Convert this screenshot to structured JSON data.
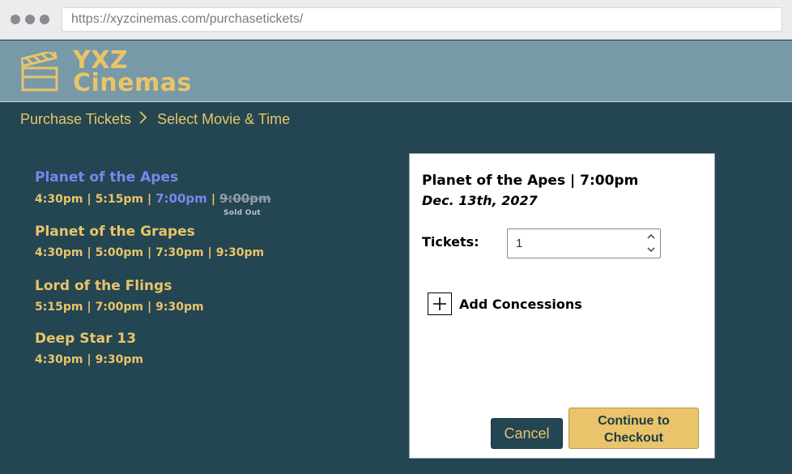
{
  "browser": {
    "url": "https://xyzcinemas.com/purchasetickets/"
  },
  "header": {
    "logo_line1": "YXZ",
    "logo_line2": "Cinemas"
  },
  "breadcrumb": {
    "items": [
      "Purchase Tickets",
      "Select Movie & Time"
    ],
    "separator": ">"
  },
  "movies": [
    {
      "title": "Planet of the Apes",
      "selected": true,
      "times": [
        "4:30pm",
        "5:15pm",
        "7:00pm",
        "9:00pm"
      ],
      "selected_time": "7:00pm",
      "sold_out_time": "9:00pm",
      "sold_out_label": "Sold Out"
    },
    {
      "title": "Planet of the Grapes",
      "times": [
        "4:30pm",
        "5:00pm",
        "7:30pm",
        "9:30pm"
      ]
    },
    {
      "title": "Lord of the Flings",
      "times": [
        "5:15pm",
        "7:00pm",
        "9:30pm"
      ]
    },
    {
      "title": "Deep Star 13",
      "times": [
        "4:30pm",
        "9:30pm"
      ]
    }
  ],
  "panel": {
    "title": "Planet of the Apes | 7:00pm",
    "date": "Dec. 13th, 2027",
    "tickets_label": "Tickets:",
    "tickets_value": "1",
    "add_concessions_label": "Add Concessions",
    "cancel_label": "Cancel",
    "checkout_label": "Continue to\nCheckout"
  },
  "colors": {
    "background": "#244552",
    "header": "#7799a8",
    "accent": "#e9c46a",
    "selected": "#7b86ee"
  },
  "icons": {
    "logo": "clapperboard-icon",
    "breadcrumb_separator": "chevron-right-icon",
    "add": "plus-icon",
    "spin_up": "caret-up-icon",
    "spin_down": "caret-down-icon"
  }
}
